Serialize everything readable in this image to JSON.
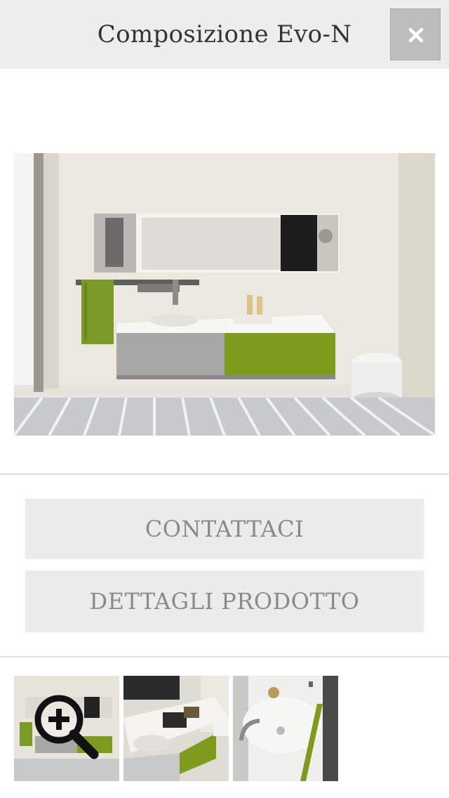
{
  "header": {
    "title": "Composizione Evo-N",
    "close_icon": "close-icon"
  },
  "main_image": {
    "description": "bathroom-vanity-photo"
  },
  "buttons": {
    "contact_label": "CONTATTACI",
    "details_label": "DETTAGLI PRODOTTO"
  },
  "thumbnails": [
    {
      "icon": "zoom-in-icon"
    },
    {},
    {}
  ],
  "colors": {
    "header_bg": "#ededed",
    "close_bg": "#bdbdbd",
    "button_bg": "#ebebeb",
    "button_text": "#8a8a8a",
    "accent_green": "#8a9a1c"
  }
}
